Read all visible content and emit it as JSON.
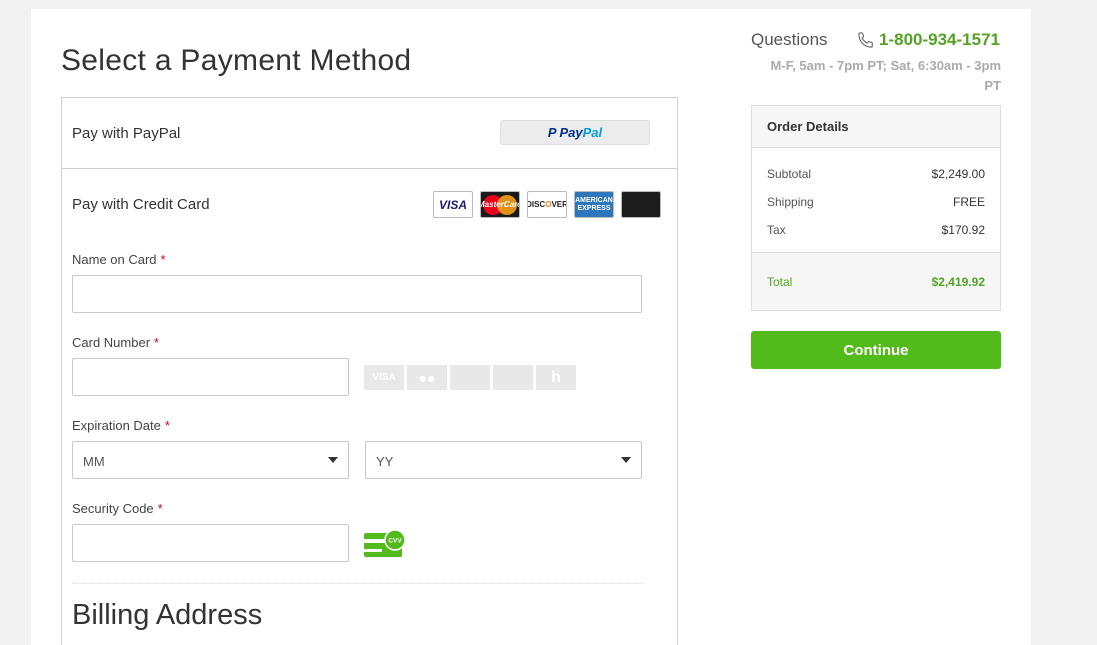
{
  "page": {
    "title": "Select a Payment Method"
  },
  "paypal": {
    "label": "Pay with PayPal",
    "button_word_a": "Pay",
    "button_word_b": "Pal",
    "button_icon": "P"
  },
  "credit_card": {
    "label": "Pay with Credit Card",
    "accepted_cards": {
      "visa": "VISA",
      "mastercard": "MasterCard",
      "discover_a": "DISC",
      "discover_b": "O",
      "discover_c": "VER",
      "amex": "AMERICAN EXPRESS"
    },
    "name_on_card": {
      "label": "Name on Card",
      "required": "*",
      "value": ""
    },
    "card_number": {
      "label": "Card Number",
      "required": "*",
      "value": ""
    },
    "card_type_icons": [
      "VISA",
      "",
      "",
      "",
      "h"
    ],
    "expiration_date": {
      "label": "Expiration Date",
      "required": "*",
      "month_placeholder": "MM",
      "year_placeholder": "YY"
    },
    "security_code": {
      "label": "Security Code",
      "required": "*",
      "value": "",
      "icon_text": "CVV"
    }
  },
  "billing": {
    "title": "Billing Address"
  },
  "support": {
    "questions_label": "Questions",
    "phone": "1-800-934-1571",
    "hours": "M-F, 5am - 7pm PT; Sat, 6:30am - 3pm PT"
  },
  "order": {
    "header": "Order Details",
    "lines": [
      {
        "label": "Subtotal",
        "value": "$2,249.00"
      },
      {
        "label": "Shipping",
        "value": "FREE"
      },
      {
        "label": "Tax",
        "value": "$170.92"
      }
    ],
    "total_label": "Total",
    "total_value": "$2,419.92"
  },
  "continue_label": "Continue",
  "colors": {
    "accent_green": "#52bb1b",
    "link_green": "#53a324",
    "required_red": "#d0021b"
  }
}
